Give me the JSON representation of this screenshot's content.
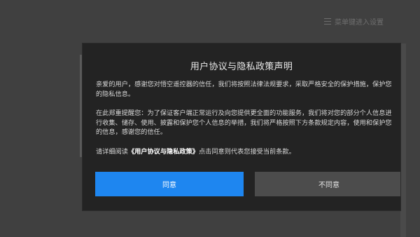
{
  "background": {
    "menu_hint": "菜单键进入设置"
  },
  "dialog": {
    "title": "用户协议与隐私政策声明",
    "paragraph1": [
      "亲爱的用户，感谢您对悟空遥控器的信任，我们将按照法律法规要求，采取严格安全的保护措施，保护您",
      "的隐私信息。"
    ],
    "paragraph2": [
      "在此郑重提醒您：为了保证客户端正常运行及向您提供更全面的功能服务，我们将对您的部分个人信息进",
      "行收集、储存、使用、披露和保护您个人信息的举措，我们将严格按照下方条款规定内容，使用和保护您",
      "的信息，感谢您的信任。"
    ],
    "paragraph3_prefix": "请详细阅读",
    "paragraph3_link": "《用户协议与隐私政策》",
    "paragraph3_suffix": "点击同意则代表您接受当前条款。",
    "agree_label": "同意",
    "disagree_label": "不同意"
  },
  "colors": {
    "agree_button": "#1e86f0",
    "disagree_button": "#4c4c4c",
    "dialog_background": "#232323",
    "overlay_background": "#404040"
  },
  "icons": [
    "menu-icon"
  ]
}
